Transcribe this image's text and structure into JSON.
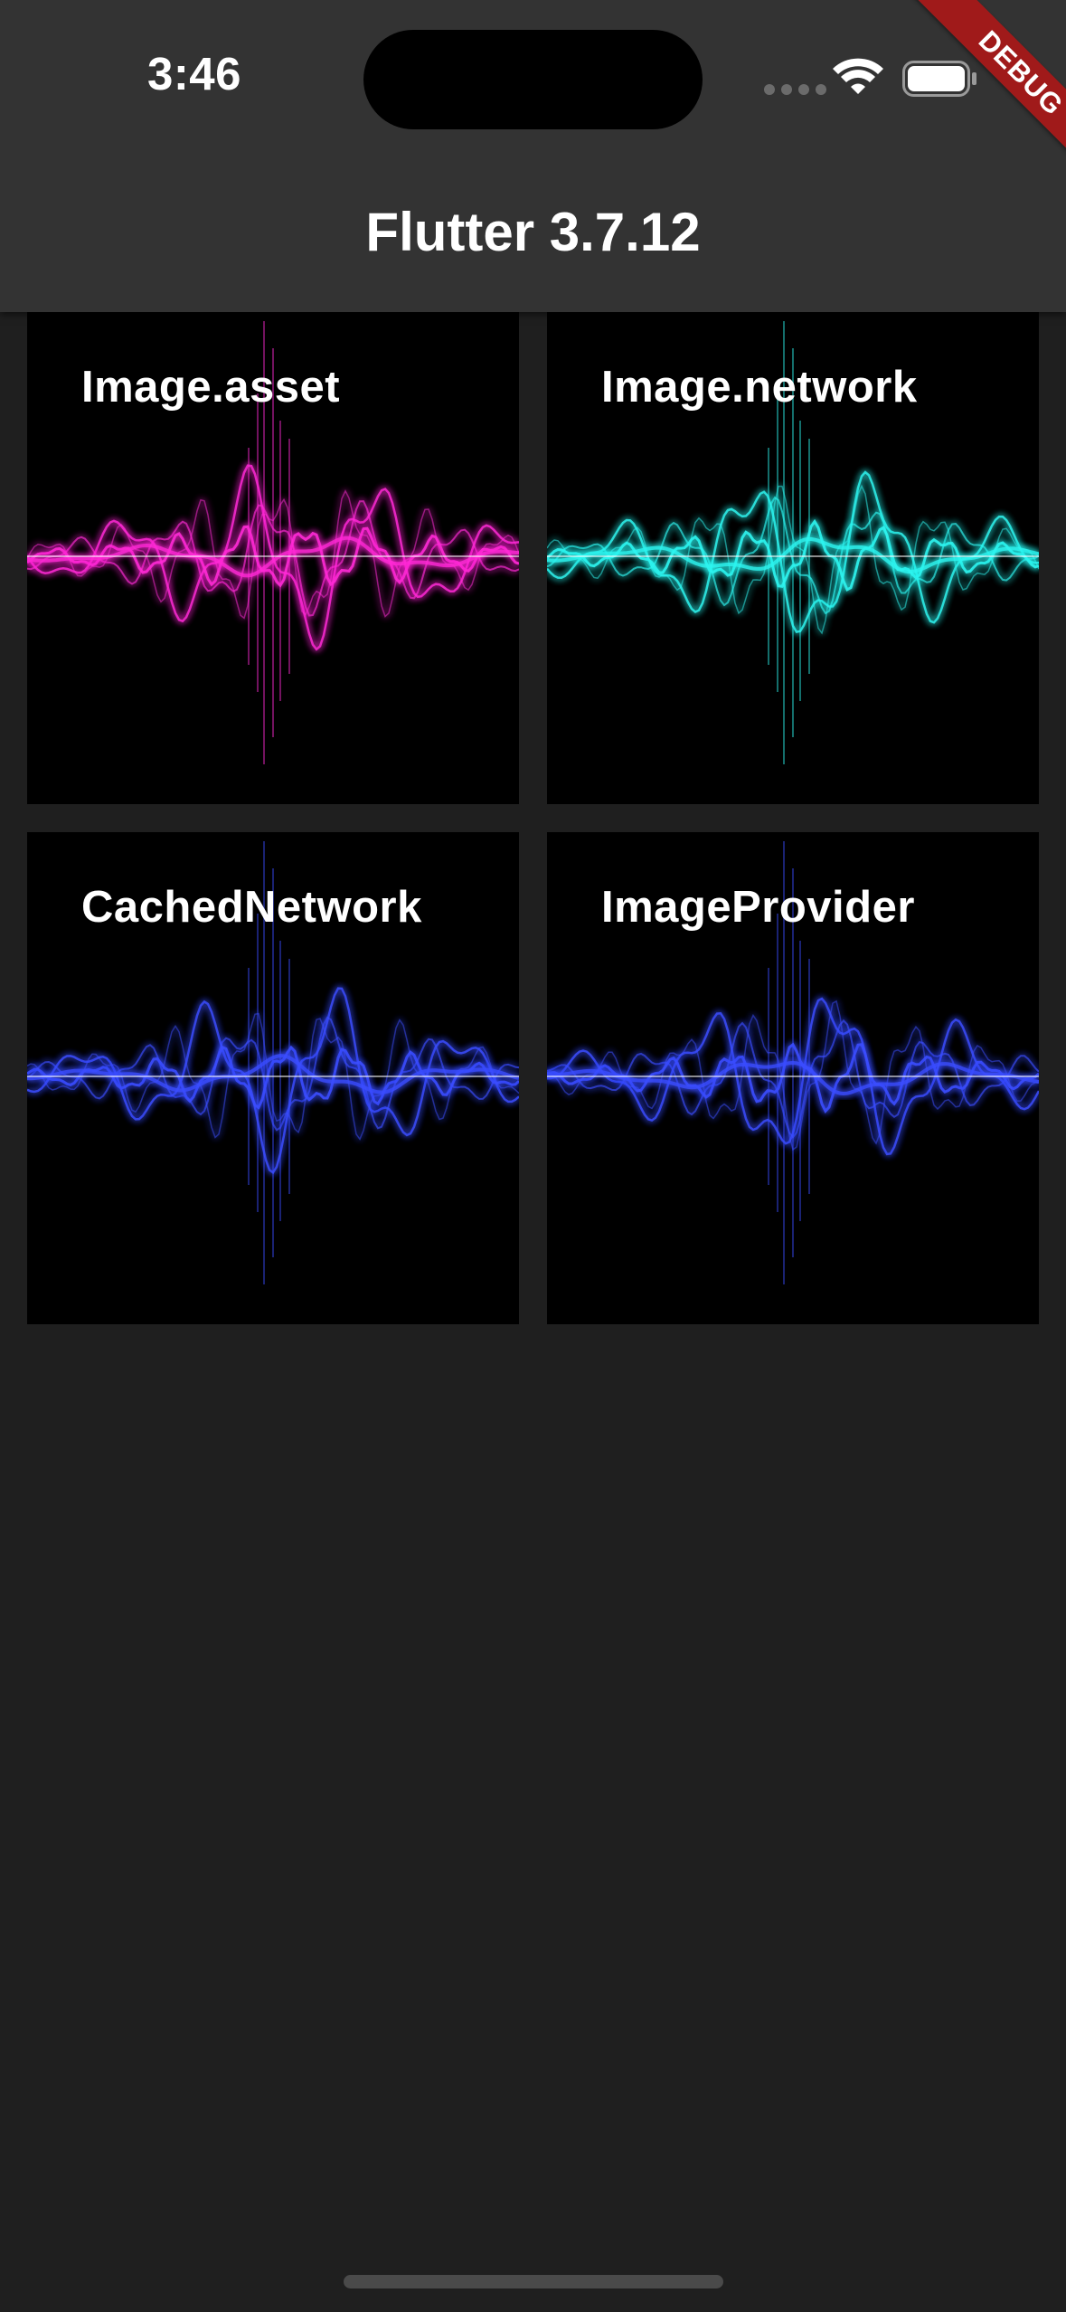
{
  "status_bar": {
    "time": "3:46"
  },
  "debug_banner": {
    "label": "DEBUG"
  },
  "app_bar": {
    "title": "Flutter 3.7.12"
  },
  "tiles": [
    {
      "label": "Image.asset",
      "color": "#ff2bd6"
    },
    {
      "label": "Image.network",
      "color": "#2ef5f0"
    },
    {
      "label": "CachedNetwork",
      "color": "#3a4dff"
    },
    {
      "label": "ImageProvider",
      "color": "#3a4dff"
    }
  ],
  "colors": {
    "background": "#1f1f1f",
    "app_bar": "#333333",
    "debug_ribbon": "#a01a1a"
  }
}
